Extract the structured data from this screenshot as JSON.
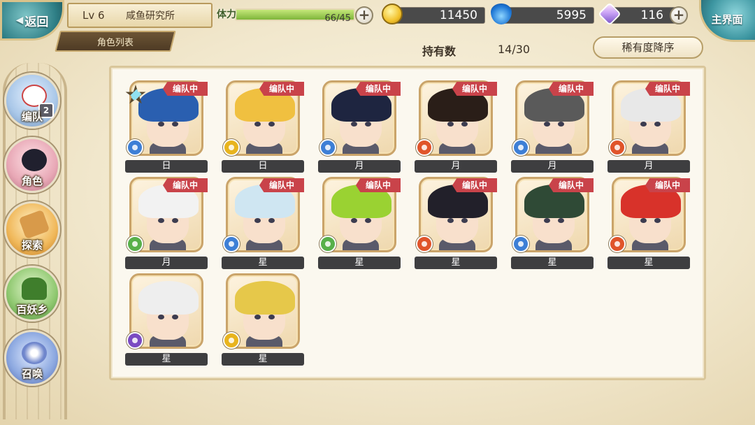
{
  "header": {
    "back_label": "返回",
    "level": "Lv 6",
    "player_name": "咸鱼研究所",
    "list_tab": "角色列表",
    "main_menu_label": "主界面"
  },
  "stamina": {
    "label": "体力",
    "value": "66/45",
    "fill_fraction": 1.0
  },
  "currencies": {
    "gold": "11450",
    "blue_flame": "5995",
    "gem": "116"
  },
  "roster": {
    "owned_label": "持有数",
    "owned_value": "14/30",
    "sort_label": "稀有度降序"
  },
  "nav": [
    {
      "label": "编队",
      "badge": "2",
      "icon": "ghost-icon"
    },
    {
      "label": "角色",
      "icon": "character-icon"
    },
    {
      "label": "探索",
      "icon": "explore-icon"
    },
    {
      "label": "百妖乡",
      "icon": "village-icon"
    },
    {
      "label": "召唤",
      "icon": "summon-icon"
    }
  ],
  "team_tag": "编队中",
  "characters": [
    {
      "name": "日",
      "in_team": true,
      "element": "water",
      "hair": "#2a5fb0",
      "star": true
    },
    {
      "name": "日",
      "in_team": true,
      "element": "light",
      "hair": "#f0c040"
    },
    {
      "name": "月",
      "in_team": true,
      "element": "water",
      "hair": "#1e2540"
    },
    {
      "name": "月",
      "in_team": true,
      "element": "fire",
      "hair": "#2a1e18"
    },
    {
      "name": "月",
      "in_team": true,
      "element": "water",
      "hair": "#5a5a5a"
    },
    {
      "name": "月",
      "in_team": true,
      "element": "fire",
      "hair": "#e8e8e8"
    },
    {
      "name": "月",
      "in_team": true,
      "element": "wind",
      "hair": "#f2f2f2"
    },
    {
      "name": "星",
      "in_team": true,
      "element": "water",
      "hair": "#cfe6f2"
    },
    {
      "name": "星",
      "in_team": true,
      "element": "wind",
      "hair": "#9ad232"
    },
    {
      "name": "星",
      "in_team": true,
      "element": "fire",
      "hair": "#22202a"
    },
    {
      "name": "星",
      "in_team": true,
      "element": "water",
      "hair": "#2f4a36"
    },
    {
      "name": "星",
      "in_team": true,
      "element": "fire",
      "hair": "#d8322a"
    },
    {
      "name": "星",
      "in_team": false,
      "element": "dark",
      "hair": "#eeeeee"
    },
    {
      "name": "星",
      "in_team": false,
      "element": "light",
      "hair": "#e6c84a"
    }
  ],
  "element_colors": {
    "water": "#3d7fd6",
    "fire": "#e0542a",
    "light": "#e8b41e",
    "wind": "#58b04a",
    "dark": "#7a4ac2"
  }
}
